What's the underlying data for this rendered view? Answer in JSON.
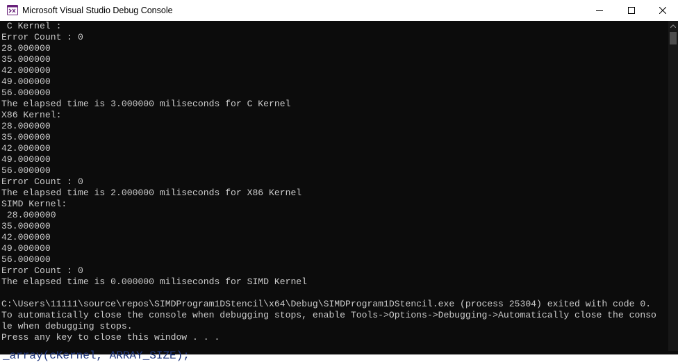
{
  "window": {
    "title": "Microsoft Visual Studio Debug Console",
    "icon": "visual-studio-console-icon",
    "controls": [
      "minimize-icon",
      "maximize-icon",
      "close-icon"
    ]
  },
  "console": {
    "lines": [
      " C Kernel :",
      "Error Count : 0",
      "28.000000",
      "35.000000",
      "42.000000",
      "49.000000",
      "56.000000",
      "The elapsed time is 3.000000 miliseconds for C Kernel",
      "X86 Kernel:",
      "28.000000",
      "35.000000",
      "42.000000",
      "49.000000",
      "56.000000",
      "Error Count : 0",
      "The elapsed time is 2.000000 miliseconds for X86 Kernel",
      "SIMD Kernel:",
      " 28.000000",
      "35.000000",
      "42.000000",
      "49.000000",
      "56.000000",
      "Error Count : 0",
      "The elapsed time is 0.000000 miliseconds for SIMD Kernel",
      "",
      "C:\\Users\\11111\\source\\repos\\SIMDProgram1DStencil\\x64\\Debug\\SIMDProgram1DStencil.exe (process 25304) exited with code 0.",
      "To automatically close the console when debugging stops, enable Tools->Options->Debugging->Automatically close the conso",
      "le when debugging stops.",
      "Press any key to close this window . . ."
    ],
    "text_color": "#cccccc",
    "background_color": "#0c0c0c"
  },
  "background_editor": {
    "partial_code": "_array(cKernel, ARRAY_SIZE);"
  }
}
